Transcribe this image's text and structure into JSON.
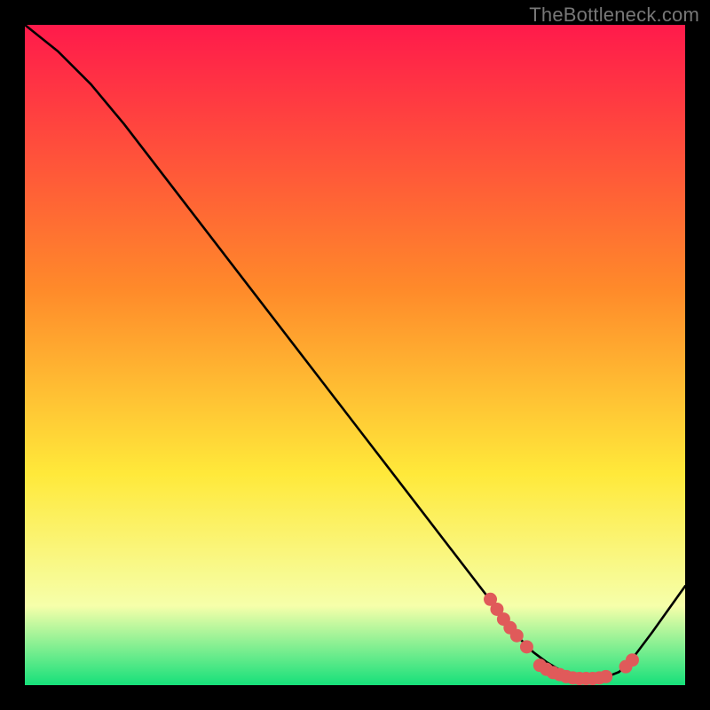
{
  "watermark": "TheBottleneck.com",
  "colors": {
    "frame": "#000000",
    "gradient_top": "#ff1a4b",
    "gradient_mid1": "#ff8a2a",
    "gradient_mid2": "#ffe93a",
    "gradient_mid3": "#f6ffaa",
    "gradient_bottom": "#16e07a",
    "curve": "#000000",
    "marker_fill": "#e05a5a",
    "marker_stroke": "#c24848"
  },
  "chart_data": {
    "type": "line",
    "title": "",
    "xlabel": "",
    "ylabel": "",
    "xlim": [
      0,
      100
    ],
    "ylim": [
      0,
      100
    ],
    "series": [
      {
        "name": "bottleneck-curve",
        "x": [
          0,
          5,
          10,
          15,
          20,
          25,
          30,
          35,
          40,
          45,
          50,
          55,
          60,
          65,
          70,
          71,
          73,
          75,
          77,
          79,
          81,
          83,
          85,
          87,
          88,
          90,
          92,
          95,
          100
        ],
        "y": [
          100,
          96,
          91,
          85,
          78.5,
          72,
          65.5,
          59,
          52.5,
          46,
          39.5,
          33,
          26.5,
          20,
          13.5,
          12,
          9.5,
          7,
          5,
          3.5,
          2.3,
          1.5,
          1,
          1,
          1.2,
          2,
          4,
          8,
          15
        ]
      }
    ],
    "markers": [
      {
        "x": 70.5,
        "y": 13
      },
      {
        "x": 71.5,
        "y": 11.5
      },
      {
        "x": 72.5,
        "y": 10
      },
      {
        "x": 73.5,
        "y": 8.7
      },
      {
        "x": 74.5,
        "y": 7.5
      },
      {
        "x": 76.0,
        "y": 5.8
      },
      {
        "x": 78.0,
        "y": 3.0
      },
      {
        "x": 79.0,
        "y": 2.4
      },
      {
        "x": 80.0,
        "y": 1.9
      },
      {
        "x": 81.0,
        "y": 1.6
      },
      {
        "x": 82.0,
        "y": 1.3
      },
      {
        "x": 83.0,
        "y": 1.1
      },
      {
        "x": 84.0,
        "y": 1.0
      },
      {
        "x": 85.0,
        "y": 1.0
      },
      {
        "x": 86.0,
        "y": 1.0
      },
      {
        "x": 87.0,
        "y": 1.1
      },
      {
        "x": 88.0,
        "y": 1.3
      },
      {
        "x": 91.0,
        "y": 2.8
      },
      {
        "x": 92.0,
        "y": 3.8
      }
    ]
  }
}
